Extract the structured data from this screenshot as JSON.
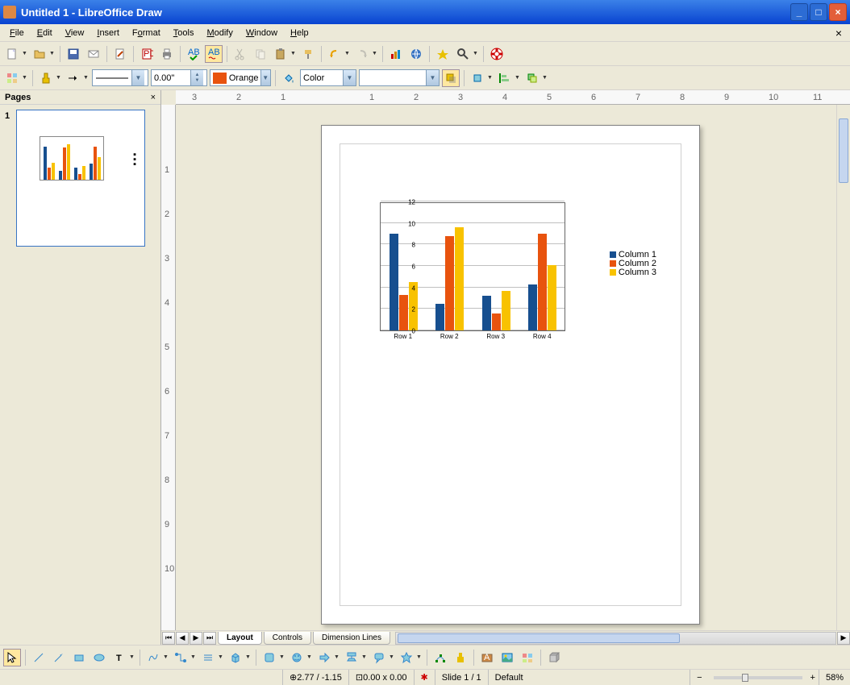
{
  "window": {
    "title": "Untitled 1 - LibreOffice Draw"
  },
  "menus": [
    "File",
    "Edit",
    "View",
    "Insert",
    "Format",
    "Tools",
    "Modify",
    "Window",
    "Help"
  ],
  "toolbar2": {
    "line_width": "0.00\"",
    "line_color_label": "Orange",
    "area_mode": "Color"
  },
  "pages_panel": {
    "title": "Pages",
    "page_num": "1"
  },
  "ruler_h": [
    "3",
    "2",
    "1",
    "",
    "1",
    "2",
    "3",
    "4",
    "5",
    "6",
    "7",
    "8",
    "9",
    "10",
    "11"
  ],
  "ruler_v": [
    "",
    "1",
    "2",
    "3",
    "4",
    "5",
    "6",
    "7",
    "8",
    "9",
    "10"
  ],
  "tabs": [
    "Layout",
    "Controls",
    "Dimension Lines"
  ],
  "statusbar": {
    "pos": "2.77 / -1.15",
    "size": "0.00 x 0.00",
    "slide": "Slide 1 / 1",
    "layout": "Default",
    "zoom": "58%"
  },
  "chart_data": {
    "type": "bar",
    "categories": [
      "Row 1",
      "Row 2",
      "Row 3",
      "Row 4"
    ],
    "series": [
      {
        "name": "Column 1",
        "color": "#174f8f",
        "values": [
          9.0,
          2.5,
          3.2,
          4.3
        ]
      },
      {
        "name": "Column 2",
        "color": "#e8530e",
        "values": [
          3.3,
          8.8,
          1.6,
          9.0
        ]
      },
      {
        "name": "Column 3",
        "color": "#f8c200",
        "values": [
          4.5,
          9.6,
          3.7,
          6.1
        ]
      }
    ],
    "ylim": [
      0,
      12
    ],
    "yticks": [
      0,
      2,
      4,
      6,
      8,
      10,
      12
    ],
    "xlabel": "",
    "ylabel": "",
    "title": ""
  }
}
